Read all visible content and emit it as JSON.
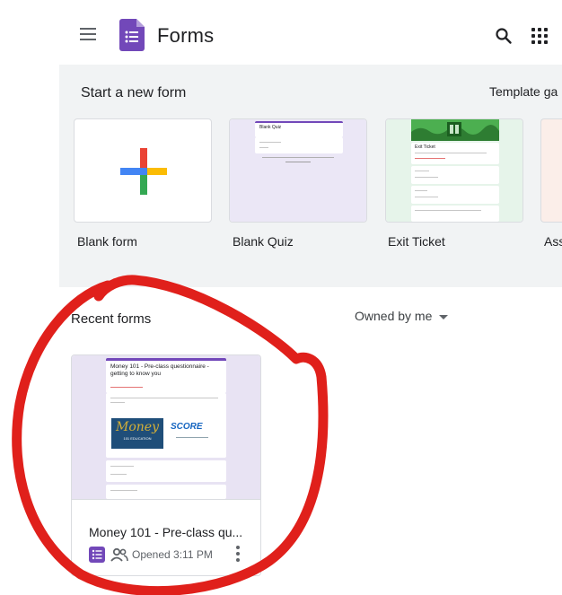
{
  "header": {
    "app_title": "Forms",
    "icons": [
      "menu-icon",
      "forms-logo-icon",
      "search-icon",
      "apps-grid-icon"
    ]
  },
  "templates": {
    "section_title": "Start a new form",
    "gallery_label": "Template ga",
    "items": [
      {
        "label": "Blank form"
      },
      {
        "label": "Blank Quiz",
        "thumb_title": "Blank Quiz"
      },
      {
        "label": "Exit Ticket",
        "thumb_title": "Exit Ticket"
      },
      {
        "label": "Ass"
      }
    ]
  },
  "recent": {
    "title": "Recent forms",
    "owner_filter": "Owned by me",
    "docs": [
      {
        "title": "Money 101 - Pre-class qu...",
        "opened": "Opened 3:11 PM",
        "thumb_heading": "Money 101 - Pre-class questionnaire - getting to know you",
        "brand_left": "Money",
        "brand_left_sub": "101 EDUCATION",
        "brand_right": "SCORE"
      }
    ]
  },
  "colors": {
    "forms_purple": "#7248b9",
    "annotation_red": "#e0201b",
    "google_blue": "#4285f4",
    "google_red": "#ea4335",
    "google_yellow": "#fbbc04",
    "google_green": "#34a853"
  }
}
